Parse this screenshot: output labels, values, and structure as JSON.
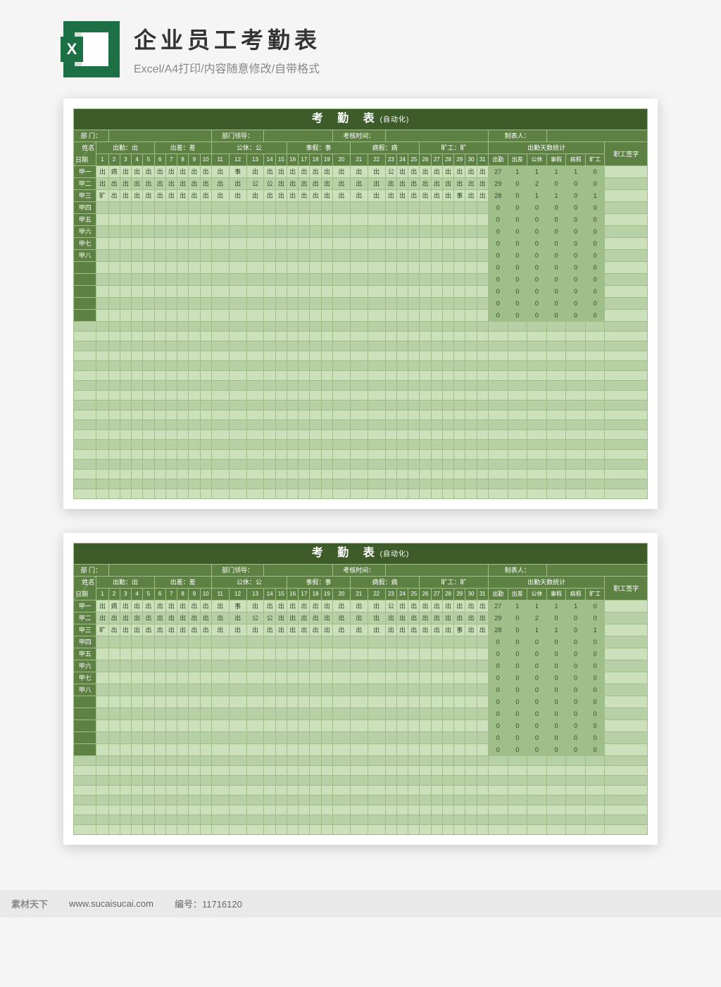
{
  "header": {
    "title": "企业员工考勤表",
    "subtitle": "Excel/A4打印/内容随意修改/自带格式",
    "icon_letter": "X"
  },
  "sheet": {
    "title_main": "考 勤 表",
    "title_sub": "(自动化)",
    "info": {
      "dept": "部 门：",
      "leader": "部门领导：",
      "period": "考核时间：",
      "maker": "制表人："
    },
    "legend": {
      "items": [
        {
          "label": "出勤",
          "code": "出"
        },
        {
          "label": "出差",
          "code": "差"
        },
        {
          "label": "公休",
          "code": "公"
        },
        {
          "label": "事假",
          "code": "事"
        },
        {
          "label": "病假",
          "code": "病"
        },
        {
          "label": "旷工",
          "code": "旷"
        }
      ],
      "stats_title": "出勤天数统计",
      "sign": "职工签字"
    },
    "diag": {
      "top": "姓名",
      "bottom": "日期"
    },
    "days": [
      "1",
      "2",
      "3",
      "4",
      "5",
      "6",
      "7",
      "8",
      "9",
      "10",
      "11",
      "12",
      "13",
      "14",
      "15",
      "16",
      "17",
      "18",
      "19",
      "20",
      "21",
      "22",
      "23",
      "24",
      "25",
      "26",
      "27",
      "28",
      "29",
      "30",
      "31"
    ],
    "stat_cols": [
      "出勤",
      "出差",
      "公休",
      "事假",
      "病假",
      "旷工"
    ],
    "rows": [
      {
        "name": "甲一",
        "cells": [
          "出",
          "病",
          "出",
          "出",
          "出",
          "出",
          "出",
          "出",
          "出",
          "出",
          "出",
          "事",
          "出",
          "出",
          "出",
          "出",
          "出",
          "出",
          "出",
          "出",
          "出",
          "出",
          "公",
          "出",
          "出",
          "出",
          "出",
          "出",
          "出",
          "出",
          "出"
        ],
        "stats": [
          "27",
          "1",
          "1",
          "1",
          "1",
          "0"
        ]
      },
      {
        "name": "甲二",
        "cells": [
          "出",
          "出",
          "出",
          "出",
          "出",
          "出",
          "出",
          "出",
          "出",
          "出",
          "出",
          "出",
          "公",
          "公",
          "出",
          "出",
          "出",
          "出",
          "出",
          "出",
          "出",
          "出",
          "出",
          "出",
          "出",
          "出",
          "出",
          "出",
          "出",
          "出",
          "出"
        ],
        "stats": [
          "29",
          "0",
          "2",
          "0",
          "0",
          "0"
        ]
      },
      {
        "name": "甲三",
        "cells": [
          "旷",
          "出",
          "出",
          "出",
          "出",
          "出",
          "出",
          "出",
          "出",
          "出",
          "出",
          "出",
          "出",
          "出",
          "出",
          "出",
          "出",
          "出",
          "出",
          "出",
          "出",
          "出",
          "出",
          "出",
          "出",
          "出",
          "出",
          "出",
          "事",
          "出",
          "出"
        ],
        "stats": [
          "28",
          "0",
          "1",
          "1",
          "0",
          "1"
        ]
      },
      {
        "name": "甲四",
        "cells": [
          "",
          "",
          "",
          "",
          "",
          "",
          "",
          "",
          "",
          "",
          "",
          "",
          "",
          "",
          "",
          "",
          "",
          "",
          "",
          "",
          "",
          "",
          "",
          "",
          "",
          "",
          "",
          "",
          "",
          "",
          ""
        ],
        "stats": [
          "0",
          "0",
          "0",
          "0",
          "0",
          "0"
        ]
      },
      {
        "name": "甲五",
        "cells": [
          "",
          "",
          "",
          "",
          "",
          "",
          "",
          "",
          "",
          "",
          "",
          "",
          "",
          "",
          "",
          "",
          "",
          "",
          "",
          "",
          "",
          "",
          "",
          "",
          "",
          "",
          "",
          "",
          "",
          "",
          ""
        ],
        "stats": [
          "0",
          "0",
          "0",
          "0",
          "0",
          "0"
        ]
      },
      {
        "name": "甲六",
        "cells": [
          "",
          "",
          "",
          "",
          "",
          "",
          "",
          "",
          "",
          "",
          "",
          "",
          "",
          "",
          "",
          "",
          "",
          "",
          "",
          "",
          "",
          "",
          "",
          "",
          "",
          "",
          "",
          "",
          "",
          "",
          ""
        ],
        "stats": [
          "0",
          "0",
          "0",
          "0",
          "0",
          "0"
        ]
      },
      {
        "name": "甲七",
        "cells": [
          "",
          "",
          "",
          "",
          "",
          "",
          "",
          "",
          "",
          "",
          "",
          "",
          "",
          "",
          "",
          "",
          "",
          "",
          "",
          "",
          "",
          "",
          "",
          "",
          "",
          "",
          "",
          "",
          "",
          "",
          ""
        ],
        "stats": [
          "0",
          "0",
          "0",
          "0",
          "0",
          "0"
        ]
      },
      {
        "name": "甲八",
        "cells": [
          "",
          "",
          "",
          "",
          "",
          "",
          "",
          "",
          "",
          "",
          "",
          "",
          "",
          "",
          "",
          "",
          "",
          "",
          "",
          "",
          "",
          "",
          "",
          "",
          "",
          "",
          "",
          "",
          "",
          "",
          ""
        ],
        "stats": [
          "0",
          "0",
          "0",
          "0",
          "0",
          "0"
        ]
      },
      {
        "name": "",
        "cells": [
          "",
          "",
          "",
          "",
          "",
          "",
          "",
          "",
          "",
          "",
          "",
          "",
          "",
          "",
          "",
          "",
          "",
          "",
          "",
          "",
          "",
          "",
          "",
          "",
          "",
          "",
          "",
          "",
          "",
          "",
          ""
        ],
        "stats": [
          "0",
          "0",
          "0",
          "0",
          "0",
          "0"
        ]
      },
      {
        "name": "",
        "cells": [
          "",
          "",
          "",
          "",
          "",
          "",
          "",
          "",
          "",
          "",
          "",
          "",
          "",
          "",
          "",
          "",
          "",
          "",
          "",
          "",
          "",
          "",
          "",
          "",
          "",
          "",
          "",
          "",
          "",
          "",
          ""
        ],
        "stats": [
          "0",
          "0",
          "0",
          "0",
          "0",
          "0"
        ]
      },
      {
        "name": "",
        "cells": [
          "",
          "",
          "",
          "",
          "",
          "",
          "",
          "",
          "",
          "",
          "",
          "",
          "",
          "",
          "",
          "",
          "",
          "",
          "",
          "",
          "",
          "",
          "",
          "",
          "",
          "",
          "",
          "",
          "",
          "",
          ""
        ],
        "stats": [
          "0",
          "0",
          "0",
          "0",
          "0",
          "0"
        ]
      },
      {
        "name": "",
        "cells": [
          "",
          "",
          "",
          "",
          "",
          "",
          "",
          "",
          "",
          "",
          "",
          "",
          "",
          "",
          "",
          "",
          "",
          "",
          "",
          "",
          "",
          "",
          "",
          "",
          "",
          "",
          "",
          "",
          "",
          "",
          ""
        ],
        "stats": [
          "0",
          "0",
          "0",
          "0",
          "0",
          "0"
        ]
      },
      {
        "name": "",
        "cells": [
          "",
          "",
          "",
          "",
          "",
          "",
          "",
          "",
          "",
          "",
          "",
          "",
          "",
          "",
          "",
          "",
          "",
          "",
          "",
          "",
          "",
          "",
          "",
          "",
          "",
          "",
          "",
          "",
          "",
          "",
          ""
        ],
        "stats": [
          "0",
          "0",
          "0",
          "0",
          "0",
          "0"
        ]
      }
    ],
    "extra_striped_rows": 18
  },
  "footer": {
    "site_cn": "素材天下",
    "site_url": "www.sucaisucai.com",
    "id_label": "编号：",
    "id_value": "11716120"
  }
}
